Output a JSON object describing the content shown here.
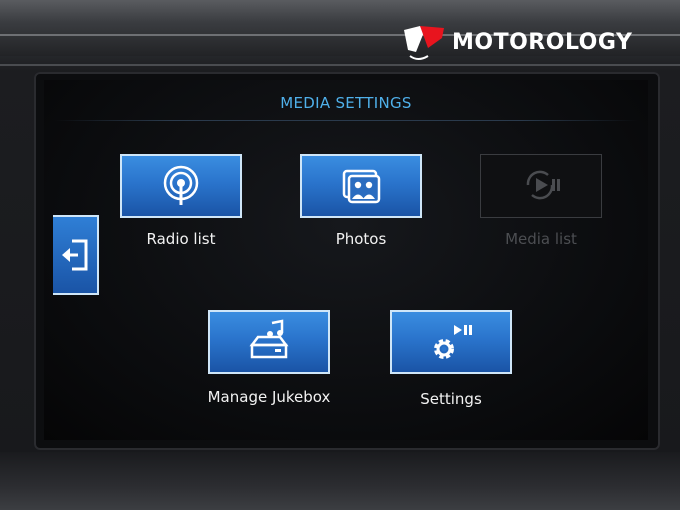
{
  "brand": {
    "name": "MOTOROLOGY",
    "colors": {
      "accent": "#e8141e",
      "text": "#ffffff"
    },
    "icon": "motorology-logo"
  },
  "screen": {
    "title": "MEDIA SETTINGS",
    "title_color": "#4fb0ea",
    "back_button": {
      "icon": "back-exit-icon"
    },
    "menu": [
      {
        "id": "radio-list",
        "label": "Radio list",
        "icon": "radio-antenna-icon",
        "enabled": true
      },
      {
        "id": "photos",
        "label": "Photos",
        "icon": "photos-icon",
        "enabled": true
      },
      {
        "id": "media-list",
        "label": "Media list",
        "icon": "media-playback-icon",
        "enabled": false
      },
      {
        "id": "manage-jukebox",
        "label": "Manage Jukebox",
        "icon": "jukebox-drive-icon",
        "enabled": true
      },
      {
        "id": "settings",
        "label": "Settings",
        "icon": "gear-play-pause-icon",
        "enabled": true
      }
    ],
    "colors": {
      "tile_blue": "#2a74cc",
      "tile_border": "#cfe6f8",
      "disabled": "#4c4e52"
    }
  }
}
